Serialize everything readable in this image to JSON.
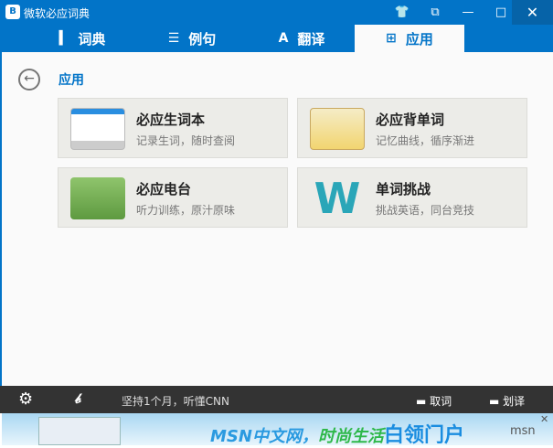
{
  "window": {
    "title": "微软必应词典",
    "controls": [
      "skin",
      "mini",
      "minimize",
      "maximize",
      "close"
    ]
  },
  "tabs": [
    {
      "label": "词典",
      "icon": "book-icon"
    },
    {
      "label": "例句",
      "icon": "list-icon"
    },
    {
      "label": "翻译",
      "icon": "translate-icon"
    },
    {
      "label": "应用",
      "icon": "apps-icon",
      "active": true
    }
  ],
  "main": {
    "heading": "应用",
    "cards": [
      {
        "title": "必应生词本",
        "subtitle": "记录生词，随时查阅"
      },
      {
        "title": "必应背单词",
        "subtitle": "记忆曲线，循序渐进"
      },
      {
        "title": "必应电台",
        "subtitle": "听力训练，原汁原味"
      },
      {
        "title": "单词挑战",
        "subtitle": "挑战英语，同台竞技"
      }
    ]
  },
  "bottom": {
    "slogan": "坚持1个月，听懂CNN",
    "lookup": "取词",
    "select_translate": "划译"
  },
  "ad": {
    "text1": "MSN中文网，",
    "text2": "时尚生活",
    "text3": "白领门户",
    "brand": "msn"
  }
}
